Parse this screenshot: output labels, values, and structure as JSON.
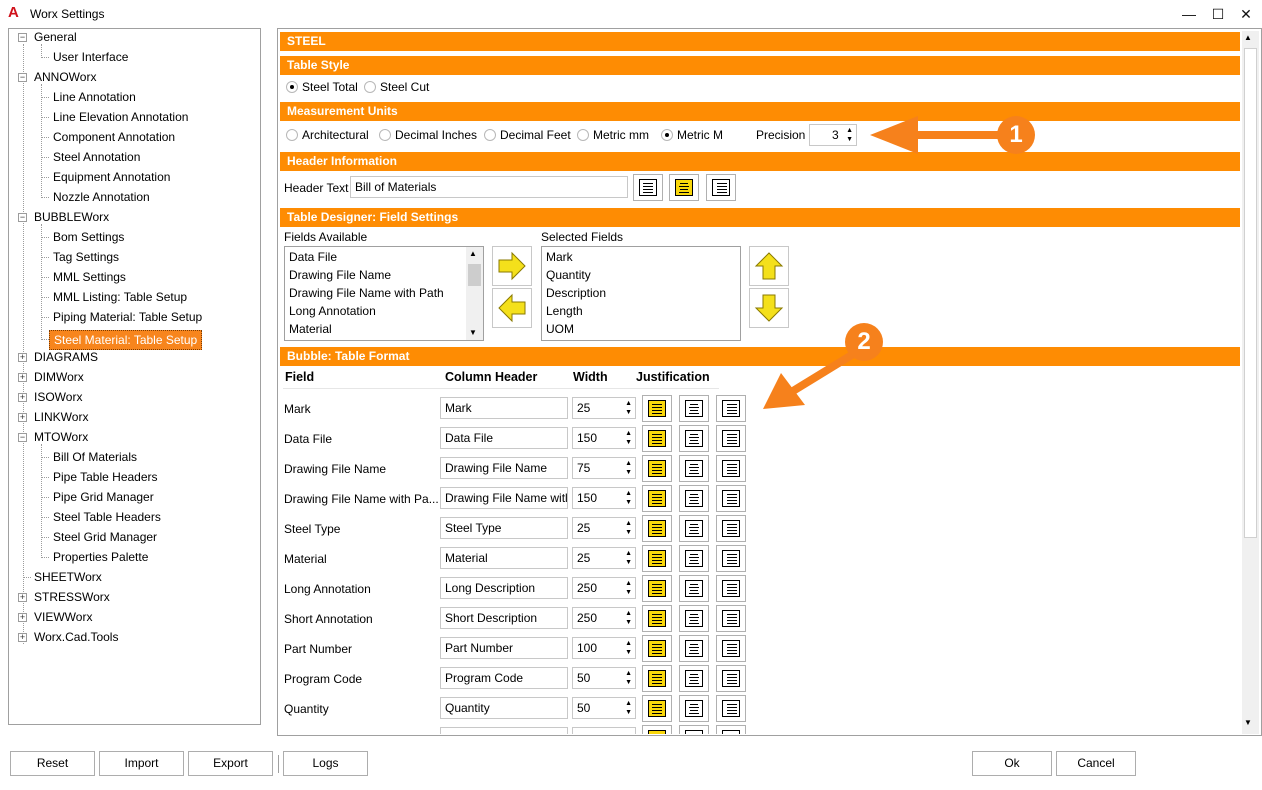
{
  "window": {
    "title": "Worx Settings",
    "minimize": "—",
    "maximize": "☐",
    "close": "✕"
  },
  "tree": {
    "general": "General",
    "user_interface": "User Interface",
    "annoworx": "ANNOWorx",
    "line_annotation": "Line Annotation",
    "line_elevation_annotation": "Line Elevation Annotation",
    "component_annotation": "Component Annotation",
    "steel_annotation": "Steel Annotation",
    "equipment_annotation": "Equipment Annotation",
    "nozzle_annotation": "Nozzle Annotation",
    "bubbleworx": "BUBBLEWorx",
    "bom_settings": "Bom Settings",
    "tag_settings": "Tag Settings",
    "mml_settings": "MML Settings",
    "mml_listing": "MML Listing: Table Setup",
    "piping_material": "Piping Material: Table Setup",
    "steel_material": "Steel Material: Table Setup",
    "diagrams": "DIAGRAMS",
    "dimworx": "DIMWorx",
    "isoworx": "ISOWorx",
    "linkworx": "LINKWorx",
    "mtoworx": "MTOWorx",
    "bill_of_materials": "Bill Of Materials",
    "pipe_table_headers": "Pipe Table Headers",
    "pipe_grid_manager": "Pipe Grid Manager",
    "steel_table_headers": "Steel Table Headers",
    "steel_grid_manager": "Steel Grid Manager",
    "properties_palette": "Properties Palette",
    "sheetworx": "SHEETWorx",
    "stressworx": "STRESSWorx",
    "viewworx": "VIEWWorx",
    "worx_cad_tools": "Worx.Cad.Tools"
  },
  "panel": {
    "title": "STEEL",
    "table_style": {
      "heading": "Table Style",
      "steel_total": "Steel Total",
      "steel_cut": "Steel Cut",
      "selected": "Steel Total"
    },
    "measurement_units": {
      "heading": "Measurement Units",
      "architectural": "Architectural",
      "decimal_inches": "Decimal Inches",
      "decimal_feet": "Decimal Feet",
      "metric_mm": "Metric mm",
      "metric_m": "Metric M",
      "selected": "Metric M",
      "precision_label": "Precision",
      "precision_value": "3"
    },
    "header_information": {
      "heading": "Header Information",
      "label": "Header Text",
      "value": "Bill of Materials",
      "justification": "center"
    },
    "field_settings": {
      "heading": "Table Designer: Field Settings",
      "available_label": "Fields Available",
      "available": [
        "Data File",
        "Drawing File Name",
        "Drawing File Name with Path",
        "Long Annotation",
        "Material"
      ],
      "selected_label": "Selected Fields",
      "selected": [
        "Mark",
        "Quantity",
        "Description",
        "Length",
        "UOM"
      ],
      "move_right": "arrow-right-icon",
      "move_left": "arrow-left-icon",
      "move_up": "arrow-up-icon",
      "move_down": "arrow-down-icon"
    },
    "table_format": {
      "heading": "Bubble: Table Format",
      "col_field": "Field",
      "col_header": "Column Header",
      "col_width": "Width",
      "col_justification": "Justification",
      "rows": [
        {
          "field": "Mark",
          "header": "Mark",
          "width": "25",
          "justify": "left"
        },
        {
          "field": "Data File",
          "header": "Data File",
          "width": "150",
          "justify": "left"
        },
        {
          "field": "Drawing File Name",
          "header": "Drawing File Name",
          "width": "75",
          "justify": "left"
        },
        {
          "field": "Drawing File Name with Pa...",
          "header": "Drawing File Name witl",
          "width": "150",
          "justify": "left"
        },
        {
          "field": "Steel Type",
          "header": "Steel Type",
          "width": "25",
          "justify": "left"
        },
        {
          "field": "Material",
          "header": "Material",
          "width": "25",
          "justify": "left"
        },
        {
          "field": "Long Annotation",
          "header": "Long Description",
          "width": "250",
          "justify": "left"
        },
        {
          "field": "Short Annotation",
          "header": "Short Description",
          "width": "250",
          "justify": "left"
        },
        {
          "field": "Part Number",
          "header": "Part Number",
          "width": "100",
          "justify": "left"
        },
        {
          "field": "Program Code",
          "header": "Program Code",
          "width": "50",
          "justify": "left"
        },
        {
          "field": "Quantity",
          "header": "Quantity",
          "width": "50",
          "justify": "left"
        }
      ]
    }
  },
  "callouts": {
    "one": "1",
    "two": "2"
  },
  "buttons": {
    "reset": "Reset",
    "import": "Import",
    "export": "Export",
    "logs": "Logs",
    "ok": "Ok",
    "cancel": "Cancel"
  },
  "colors": {
    "accent": "#fe8c03",
    "callout": "#f6811c",
    "active_justify": "#f9d70b",
    "arrow_yellow": "#f4e01b"
  }
}
